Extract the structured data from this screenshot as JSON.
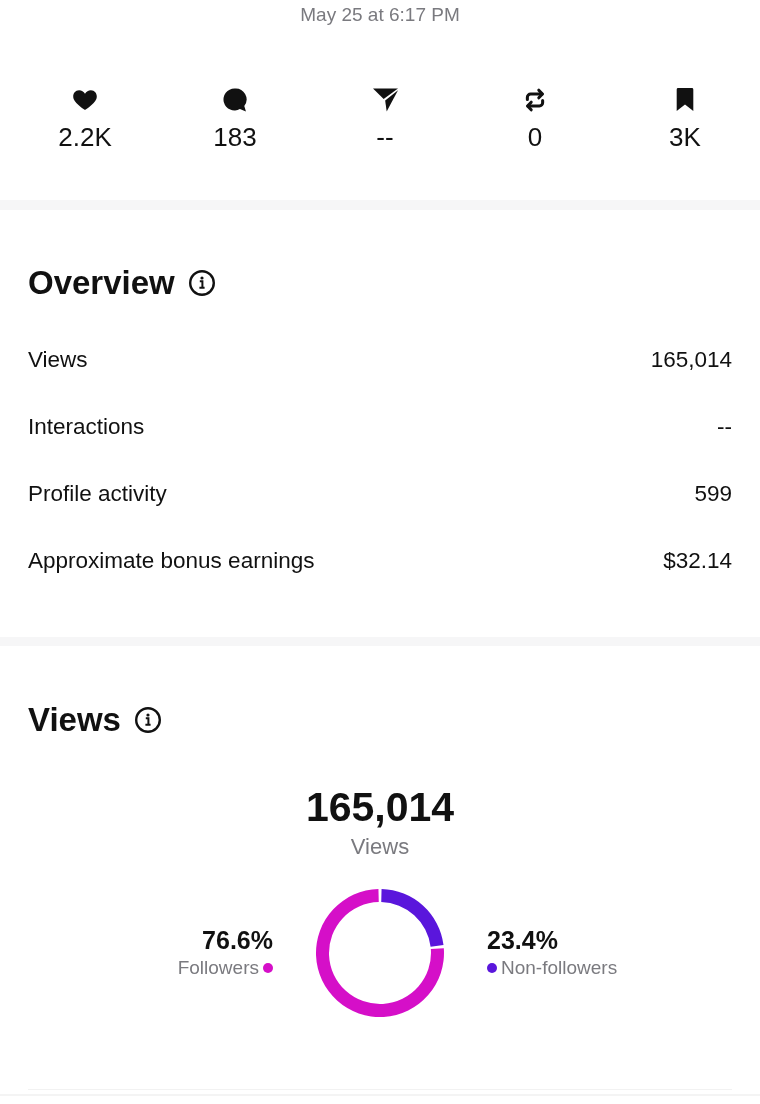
{
  "timestamp": "May 25 at 6:17 PM",
  "stats": [
    "2.2K",
    "183",
    "--",
    "0",
    "3K"
  ],
  "overview": {
    "title": "Overview",
    "rows": [
      {
        "label": "Views",
        "value": "165,014"
      },
      {
        "label": "Interactions",
        "value": "--"
      },
      {
        "label": "Profile activity",
        "value": "599"
      },
      {
        "label": "Approximate bonus earnings",
        "value": "$32.14"
      }
    ]
  },
  "views": {
    "title": "Views",
    "total": "165,014",
    "total_label": "Views",
    "legend": [
      {
        "percent": "76.6%",
        "color": "#d50fc8"
      },
      {
        "percent": "23.4%",
        "color": "#5a16dc"
      }
    ],
    "chart_data": {
      "type": "donut",
      "categories": [
        "Followers",
        "Non-followers"
      ],
      "values": [
        76.6,
        23.4
      ]
    }
  }
}
